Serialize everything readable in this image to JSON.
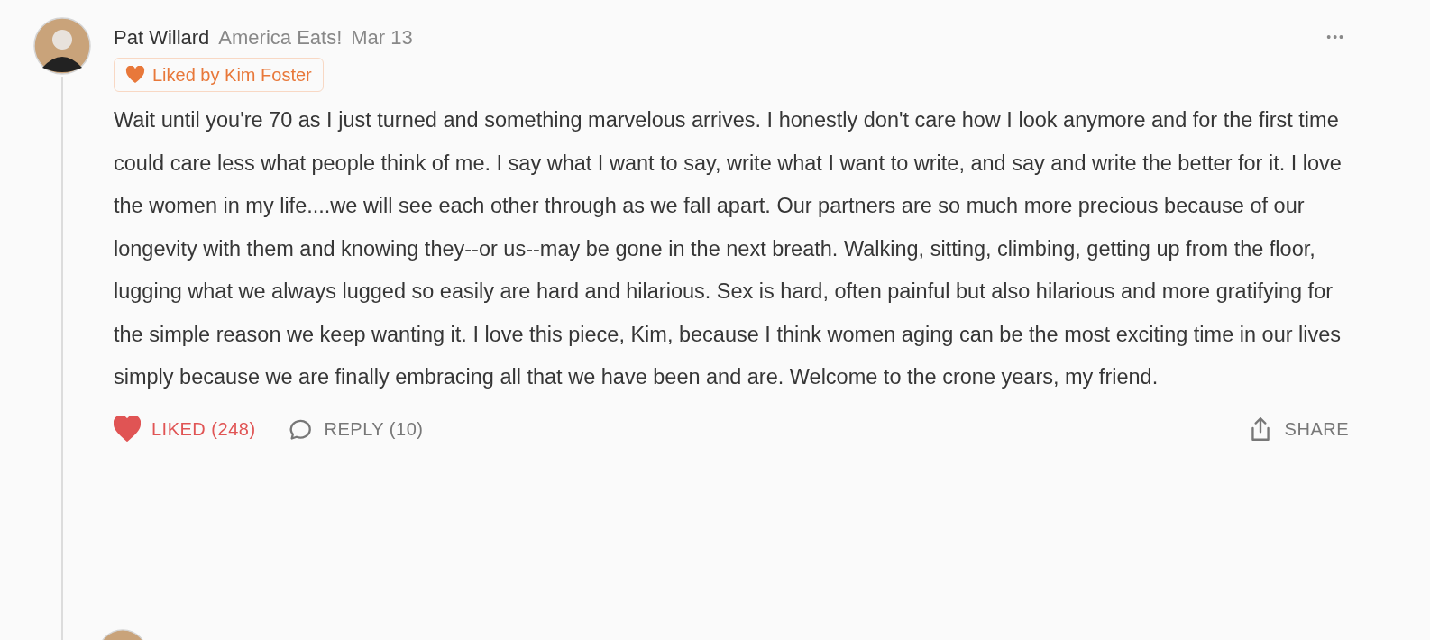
{
  "comment": {
    "author": "Pat Willard",
    "publication": "America Eats!",
    "date": "Mar 13",
    "menu": "•••",
    "liked_by": "Liked by Kim Foster",
    "body": "Wait until you're 70 as I just turned and something marvelous arrives. I honestly don't care how I look anymore and for the first time could care less what people think of me. I say what I want to say, write what I want to write, and say and write the better for it. I love the women in my life....we will see each other through as we fall apart. Our partners are so much more precious because of our longevity with them and knowing they--or us--may be gone in the next breath. Walking, sitting, climbing, getting up from the floor, lugging what we always lugged so easily are hard and hilarious. Sex is hard, often painful but also hilarious and more gratifying for the simple reason we keep wanting it. I love this piece, Kim, because I think women aging can be the most exciting time in our lives simply because we are finally embracing all that we have been and are. Welcome to the crone years, my friend.",
    "like": {
      "label": "LIKED (248)",
      "liked": true
    },
    "reply": {
      "label": "REPLY (10)"
    },
    "share": {
      "label": "SHARE"
    }
  }
}
